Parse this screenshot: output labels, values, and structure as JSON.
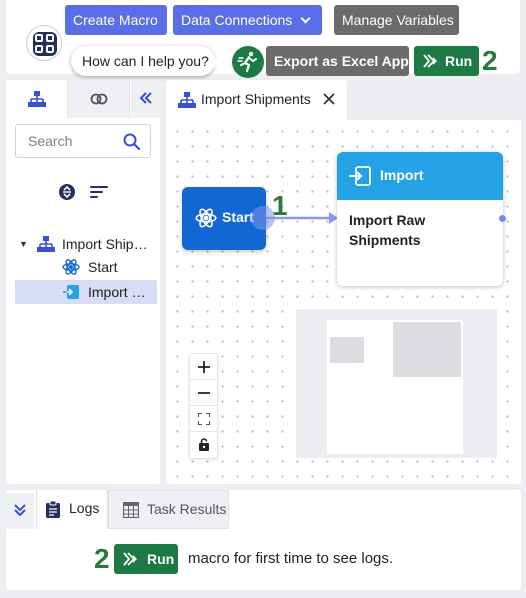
{
  "toolbar": {
    "create_macro": "Create Macro",
    "data_connections": "Data Connections",
    "manage_variables": "Manage Variables",
    "help_prompt": "How can I help you?",
    "export_excel": "Export as Excel App",
    "run": "Run",
    "run_step": "2"
  },
  "left_panel": {
    "search_placeholder": "Search",
    "tree": {
      "root": "Import Shipments",
      "children": [
        "Start",
        "Import Raw Shipments"
      ]
    }
  },
  "canvas": {
    "tab_title": "Import Shipments",
    "start_node": "Start",
    "connection_step": "1",
    "import_node": {
      "type": "Import",
      "label": "Import Raw Shipments"
    }
  },
  "bottom_panel": {
    "logs_tab": "Logs",
    "task_results_tab": "Task Results",
    "step": "2",
    "run_label": "Run",
    "message": "macro for first time to see logs."
  },
  "colors": {
    "primary_blue": "#5a6ee8",
    "gray_button": "#6b6b6b",
    "run_green": "#1d7a45",
    "start_node": "#1367d4",
    "import_header": "#23a3e6",
    "step_number_green": "#2a7a3b"
  }
}
